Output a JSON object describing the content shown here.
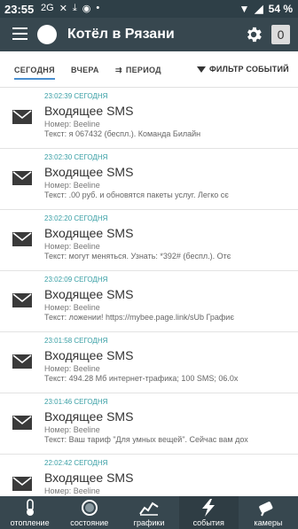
{
  "status_bar": {
    "time": "23:55",
    "signal_text": "2G",
    "battery": "54 %"
  },
  "app_bar": {
    "title": "Котёл в Рязани",
    "badge": "0"
  },
  "tabs": [
    {
      "label": "СЕГОДНЯ"
    },
    {
      "label": "ВЧЕРА"
    },
    {
      "label": "ПЕРИОД"
    }
  ],
  "filter_label": "ФИЛЬТР СОБЫТИЙ",
  "events": [
    {
      "time": "23:02:39 СЕГОДНЯ",
      "title": "Входящее SMS",
      "from": "Номер: Beeline",
      "text": "Текст: я 067432 (беспл.). Команда Билайн"
    },
    {
      "time": "23:02:30 СЕГОДНЯ",
      "title": "Входящее SMS",
      "from": "Номер: Beeline",
      "text": "Текст: .00 руб. и обновятся пакеты услуг. Легко сє"
    },
    {
      "time": "23:02:20 СЕГОДНЯ",
      "title": "Входящее SMS",
      "from": "Номер: Beeline",
      "text": "Текст: могут меняться. Узнать: *392# (беспл.). Отє"
    },
    {
      "time": "23:02:09 СЕГОДНЯ",
      "title": "Входящее SMS",
      "from": "Номер: Beeline",
      "text": "Текст: ложении! https://mybee.page.link/sUb Графиє"
    },
    {
      "time": "23:01:58 СЕГОДНЯ",
      "title": "Входящее SMS",
      "from": "Номер: Beeline",
      "text": "Текст: 494.28 Мб интернет-трафика; 100 SMS; 06.0х"
    },
    {
      "time": "23:01:46 СЕГОДНЯ",
      "title": "Входящее SMS",
      "from": "Номер: Beeline",
      "text": "Текст: Ваш тариф \"Для умных вещей\". Сейчас вам дох"
    },
    {
      "time": "22:02:42 СЕГОДНЯ",
      "title": "Входящее SMS",
      "from": "Номер: Beeline",
      "text": ""
    }
  ],
  "bottom_nav": [
    {
      "label": "отопление",
      "icon": "thermometer-icon"
    },
    {
      "label": "состояние",
      "icon": "status-ring-icon"
    },
    {
      "label": "графики",
      "icon": "chart-icon"
    },
    {
      "label": "события",
      "icon": "lightning-icon"
    },
    {
      "label": "камеры",
      "icon": "camera-icon"
    }
  ],
  "colors": {
    "appbar": "#37474f",
    "accent_time": "#3aa0a6",
    "tab_underline": "#4a8fd0"
  }
}
